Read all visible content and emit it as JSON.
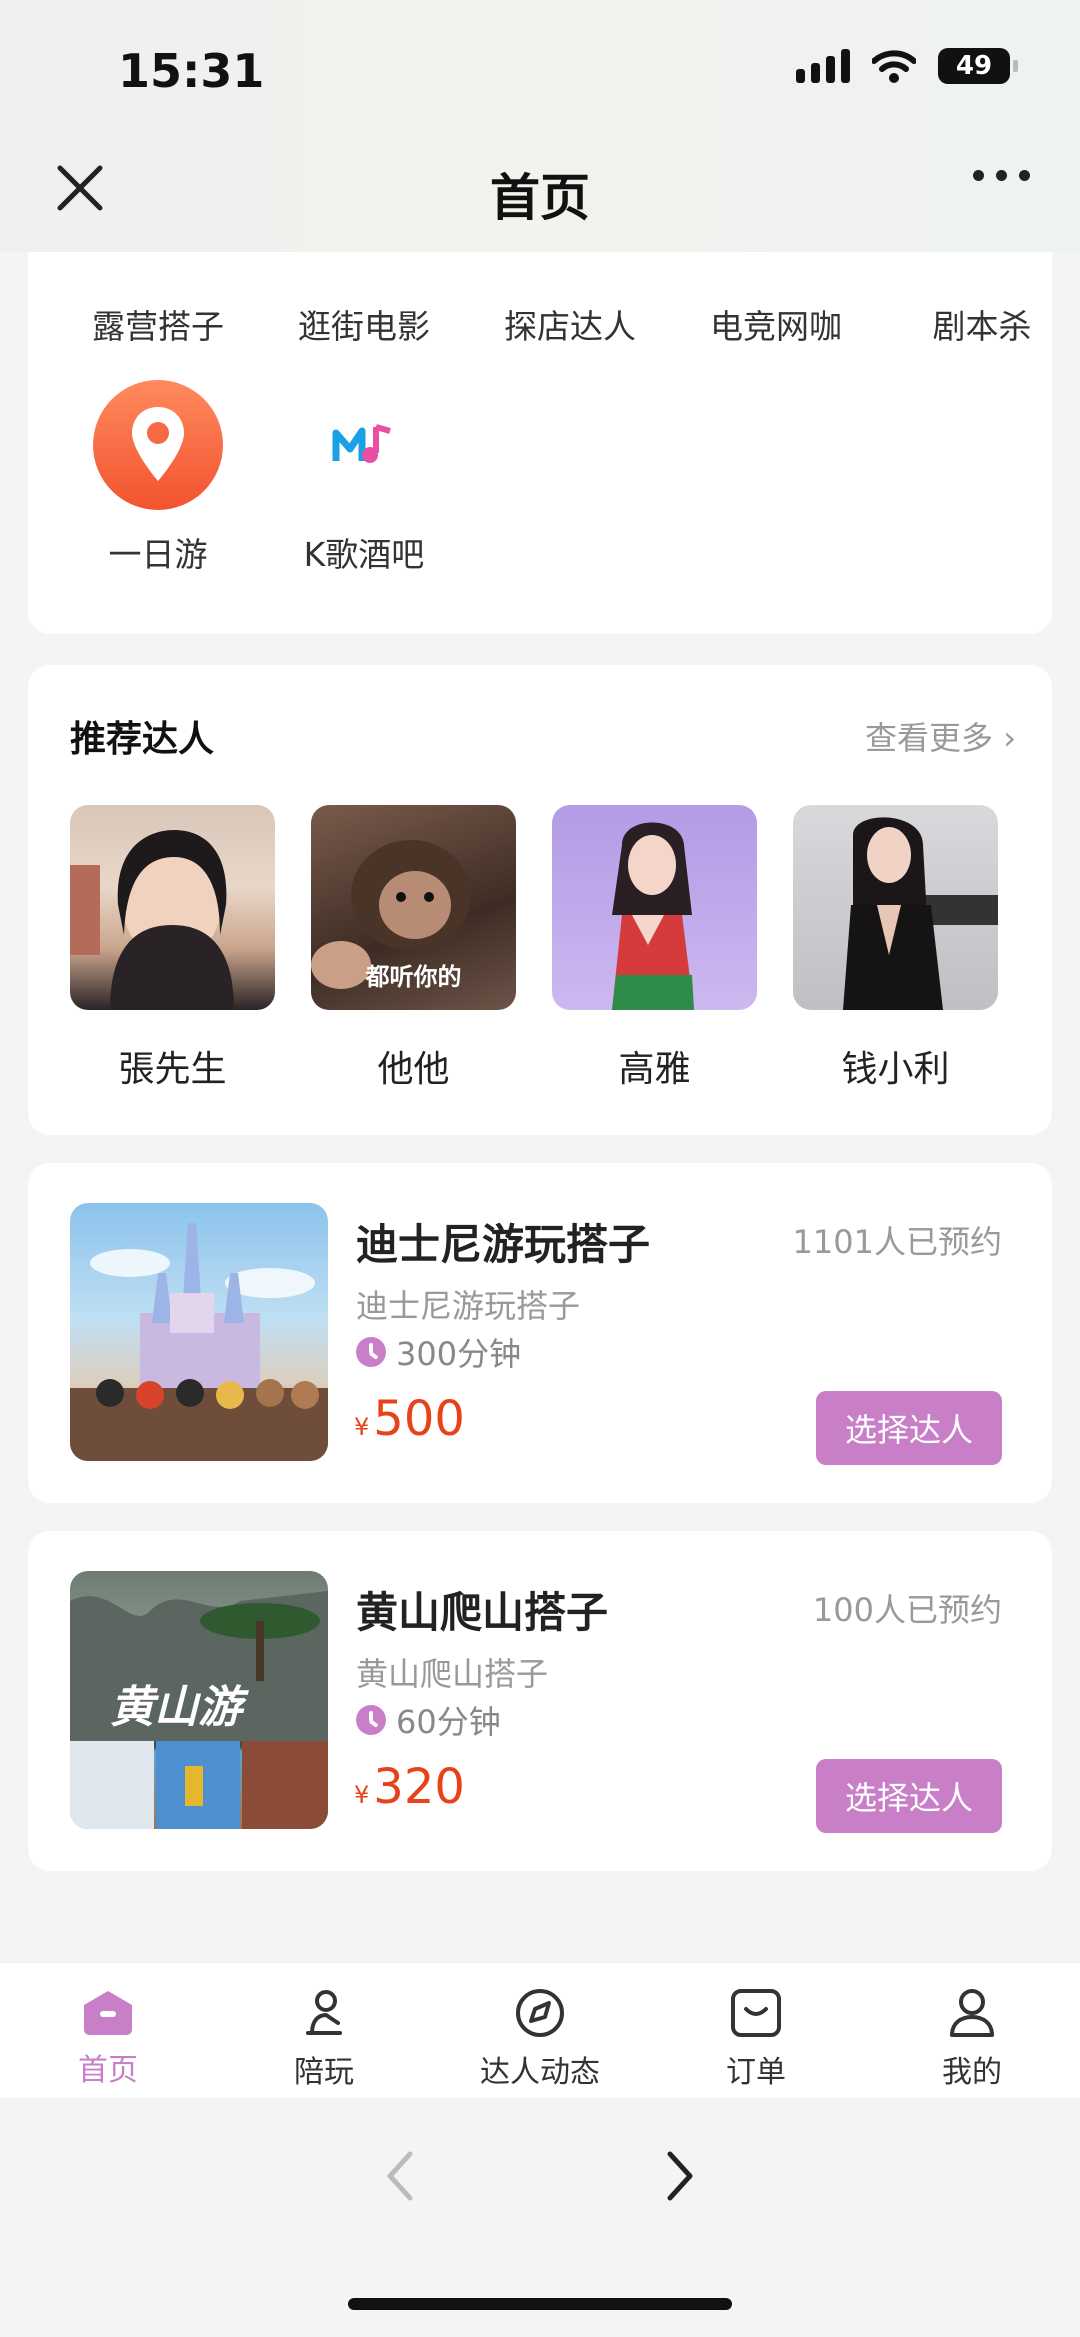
{
  "status": {
    "time": "15:31",
    "battery": "49"
  },
  "header": {
    "title": "首页"
  },
  "categories": {
    "row1": [
      {
        "label": "露营搭子",
        "color": "#8fd16a"
      },
      {
        "label": "逛街电影",
        "color": "#9fd12a"
      },
      {
        "label": "探店达人",
        "color": "#a35be0"
      },
      {
        "label": "电竞网咖",
        "color": "#26d7e8"
      },
      {
        "label": "剧本杀",
        "color": "#2ed4ea"
      }
    ],
    "row2": [
      {
        "label": "一日游",
        "icon": "location-pin-icon",
        "color": "#ff6e4a"
      },
      {
        "label": "K歌酒吧",
        "icon": "music-note-icon",
        "color": "#2aa8e8"
      }
    ]
  },
  "recommended": {
    "title": "推荐达人",
    "more": "查看更多",
    "items": [
      {
        "name": "張先生"
      },
      {
        "name": "他他",
        "caption": "都听你的"
      },
      {
        "name": "高雅"
      },
      {
        "name": "钱小利"
      }
    ]
  },
  "products": [
    {
      "title": "迪士尼游玩搭子",
      "booked": "1101人已预约",
      "subtitle": "迪士尼游玩搭子",
      "duration": "300分钟",
      "currency": "¥",
      "price": "500",
      "button": "选择达人"
    },
    {
      "title": "黄山爬山搭子",
      "booked": "100人已预约",
      "subtitle": "黄山爬山搭子",
      "duration": "60分钟",
      "currency": "¥",
      "price": "320",
      "button": "选择达人",
      "image_caption": "黄山游"
    }
  ],
  "tabs": [
    {
      "label": "首页",
      "icon": "home-icon",
      "active": true
    },
    {
      "label": "陪玩",
      "icon": "companion-icon"
    },
    {
      "label": "达人动态",
      "icon": "compass-icon"
    },
    {
      "label": "订单",
      "icon": "order-icon"
    },
    {
      "label": "我的",
      "icon": "profile-icon"
    }
  ],
  "colors": {
    "accent": "#c97fc8",
    "price": "#e8421b"
  }
}
